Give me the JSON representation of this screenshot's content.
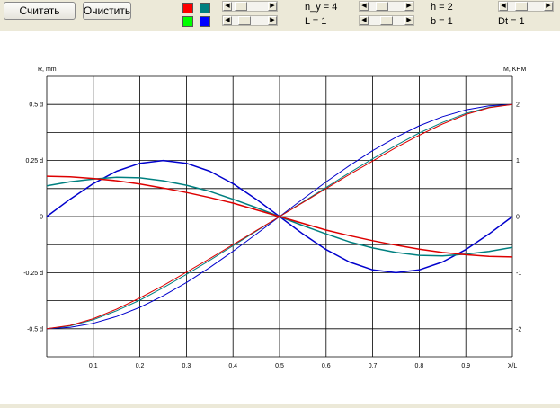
{
  "toolbar": {
    "calc_label": "Считать",
    "clear_label": "Очистить"
  },
  "swatches": {
    "red": "#ff0000",
    "teal": "#008080",
    "green": "#00ff00",
    "blue": "#0000ff"
  },
  "params": {
    "n_y": "n_y = 4",
    "h": "h = 2",
    "L": "L = 1",
    "b": "b = 1",
    "Dt": "Dt = 1"
  },
  "sliders": {
    "colorTop": 0.1,
    "colorBottom": 0.25,
    "n_y": 0.3,
    "L": 0.5,
    "h": 0.3,
    "b": 0.9,
    "Dt": 0.5
  },
  "chart_data": {
    "type": "line",
    "left_axis_label": "R, mm",
    "right_axis_label": "M, KHM",
    "x_axis_label": "X/L",
    "x_tick_labels": [
      "0.1",
      "0.2",
      "0.3",
      "0.4",
      "0.5",
      "0.6",
      "0.7",
      "0.8",
      "0.9"
    ],
    "left_tick_labels": [
      "0.5 d",
      "0.25 d",
      "0",
      "-0.25 d",
      "-0.5 d"
    ],
    "right_tick_labels": [
      "2",
      "1",
      "0",
      "-1",
      "-2"
    ],
    "xlim": [
      0,
      1
    ],
    "ylim": [
      -2.5,
      2.5
    ],
    "grid": true,
    "series": [
      {
        "color": "#0000cc",
        "width": 1.5,
        "x": [
          0,
          0.05,
          0.1,
          0.15,
          0.2,
          0.25,
          0.3,
          0.35,
          0.4,
          0.45,
          0.5,
          0.55,
          0.6,
          0.65,
          0.7,
          0.75,
          0.8,
          0.85,
          0.9,
          0.95,
          1.0
        ],
        "y": [
          0,
          0.309,
          0.588,
          0.809,
          0.951,
          1.0,
          0.951,
          0.809,
          0.588,
          0.309,
          0,
          -0.309,
          -0.588,
          -0.809,
          -0.951,
          -1.0,
          -0.951,
          -0.809,
          -0.588,
          -0.309,
          0
        ]
      },
      {
        "color": "#0000cc",
        "width": 1.0,
        "x": [
          0,
          0.05,
          0.1,
          0.15,
          0.2,
          0.25,
          0.3,
          0.35,
          0.4,
          0.45,
          0.5,
          0.55,
          0.6,
          0.65,
          0.7,
          0.75,
          0.8,
          0.85,
          0.9,
          0.95,
          1.0
        ],
        "y": [
          -2.0,
          -1.976,
          -1.902,
          -1.782,
          -1.618,
          -1.414,
          -1.176,
          -0.908,
          -0.618,
          -0.313,
          0,
          0.313,
          0.618,
          0.908,
          1.176,
          1.414,
          1.618,
          1.782,
          1.902,
          1.976,
          2.0
        ]
      },
      {
        "color": "#008080",
        "width": 1.5,
        "x": [
          0,
          0.05,
          0.1,
          0.15,
          0.2,
          0.25,
          0.3,
          0.35,
          0.4,
          0.45,
          0.5,
          0.55,
          0.6,
          0.65,
          0.7,
          0.75,
          0.8,
          0.85,
          0.9,
          0.95,
          1.0
        ],
        "y": [
          0.55,
          0.62,
          0.67,
          0.7,
          0.69,
          0.64,
          0.56,
          0.45,
          0.31,
          0.16,
          0,
          -0.16,
          -0.31,
          -0.45,
          -0.56,
          -0.64,
          -0.69,
          -0.7,
          -0.67,
          -0.62,
          -0.55
        ]
      },
      {
        "color": "#008080",
        "width": 1.0,
        "x": [
          0,
          0.05,
          0.1,
          0.15,
          0.2,
          0.25,
          0.3,
          0.35,
          0.4,
          0.45,
          0.5,
          0.55,
          0.6,
          0.65,
          0.7,
          0.75,
          0.8,
          0.85,
          0.9,
          0.95,
          1.0
        ],
        "y": [
          -2.0,
          -1.95,
          -1.84,
          -1.68,
          -1.49,
          -1.27,
          -1.03,
          -0.78,
          -0.52,
          -0.26,
          0,
          0.26,
          0.52,
          0.78,
          1.03,
          1.27,
          1.49,
          1.68,
          1.84,
          1.95,
          2.0
        ]
      },
      {
        "color": "#dd0000",
        "width": 1.5,
        "x": [
          0,
          0.05,
          0.1,
          0.15,
          0.2,
          0.25,
          0.3,
          0.35,
          0.4,
          0.45,
          0.5,
          0.55,
          0.6,
          0.65,
          0.7,
          0.75,
          0.8,
          0.85,
          0.9,
          0.95,
          1.0
        ],
        "y": [
          0.72,
          0.71,
          0.68,
          0.64,
          0.58,
          0.51,
          0.43,
          0.34,
          0.24,
          0.12,
          0,
          -0.12,
          -0.24,
          -0.34,
          -0.43,
          -0.51,
          -0.58,
          -0.64,
          -0.68,
          -0.71,
          -0.72
        ]
      },
      {
        "color": "#dd0000",
        "width": 1.0,
        "x": [
          0,
          0.05,
          0.1,
          0.15,
          0.2,
          0.25,
          0.3,
          0.35,
          0.4,
          0.45,
          0.5,
          0.55,
          0.6,
          0.65,
          0.7,
          0.75,
          0.8,
          0.85,
          0.9,
          0.95,
          1.0
        ],
        "y": [
          -2.0,
          -1.94,
          -1.82,
          -1.65,
          -1.45,
          -1.23,
          -0.99,
          -0.75,
          -0.5,
          -0.25,
          0,
          0.25,
          0.5,
          0.75,
          0.99,
          1.23,
          1.45,
          1.65,
          1.82,
          1.94,
          2.0
        ]
      }
    ]
  }
}
